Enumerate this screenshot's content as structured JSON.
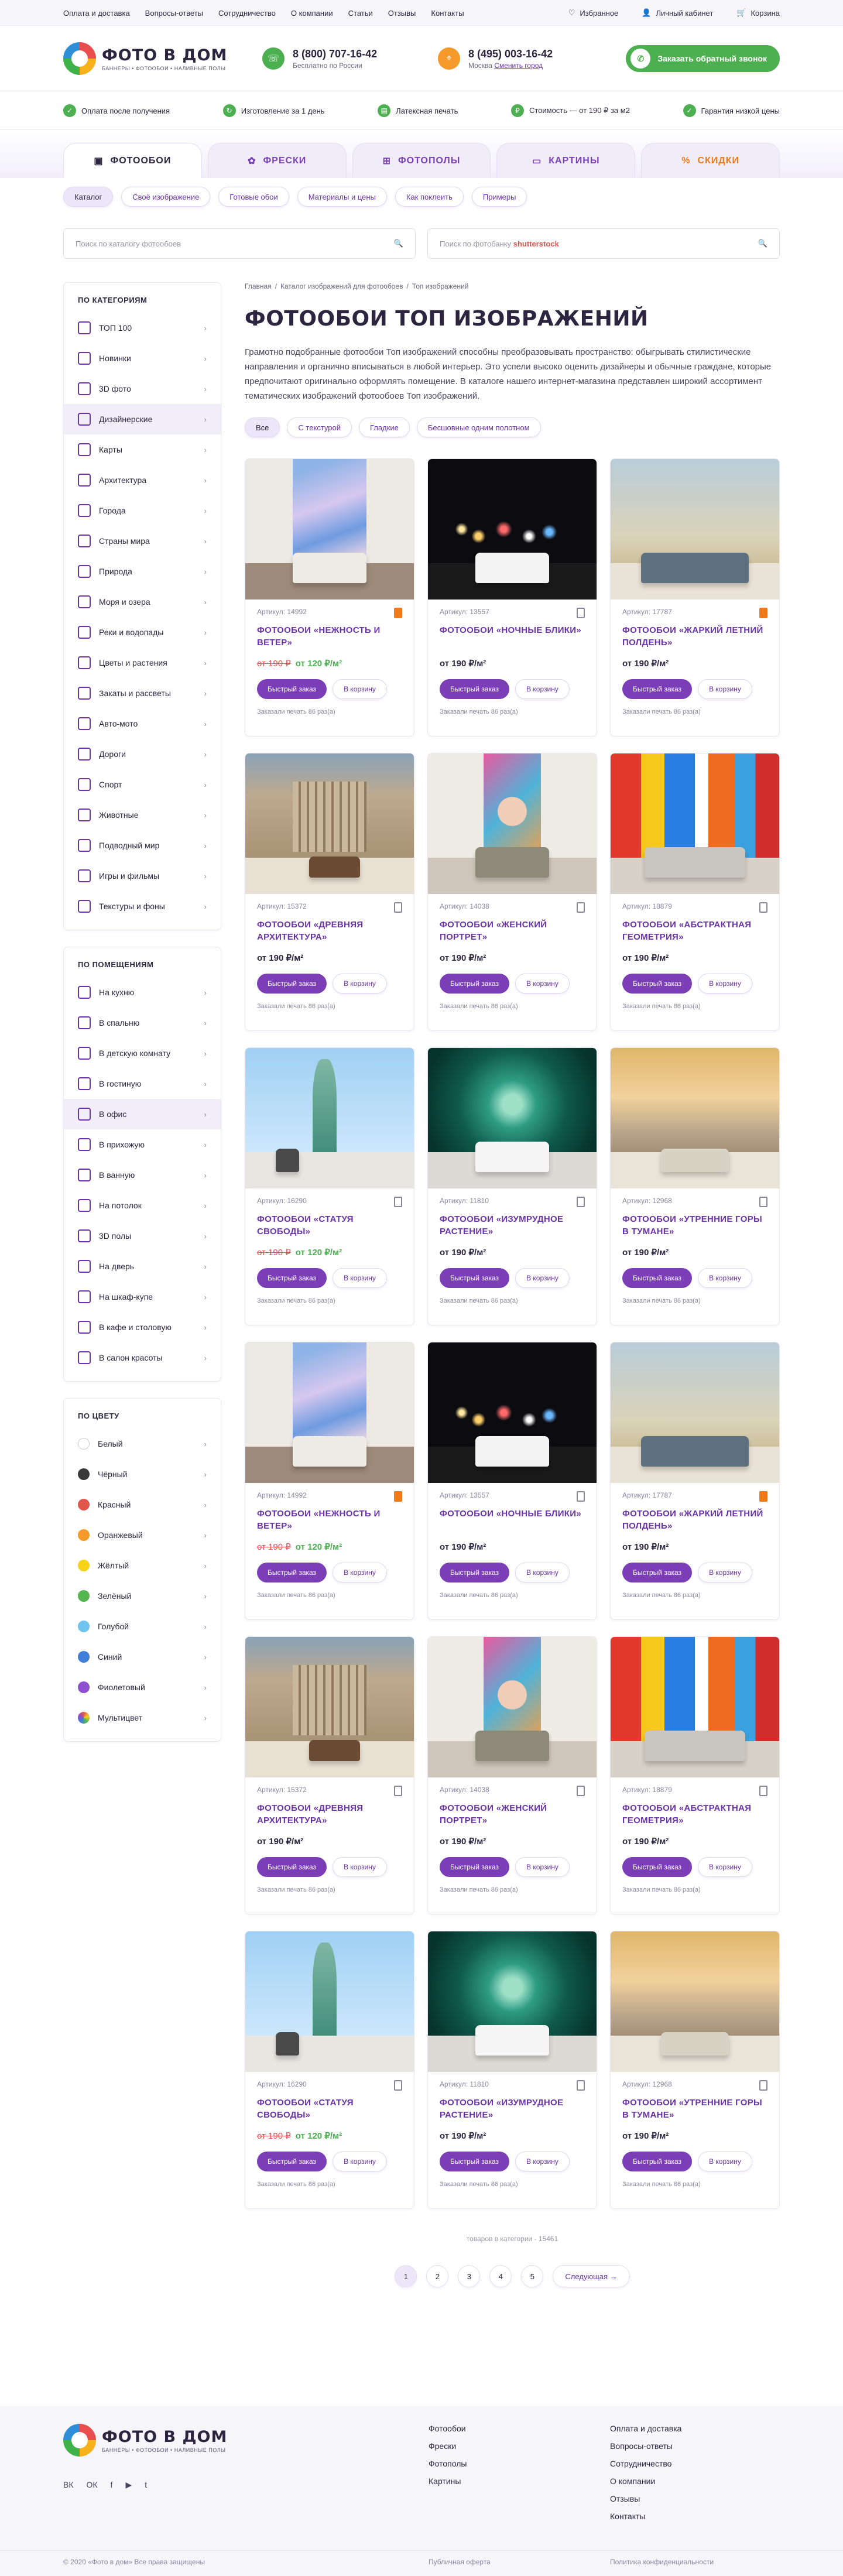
{
  "topbar": {
    "links": [
      "Оплата и доставка",
      "Вопросы-ответы",
      "Сотрудничество",
      "О компании",
      "Статьи",
      "Отзывы",
      "Контакты"
    ],
    "favorites": "Избранное",
    "cabinet": "Личный кабинет",
    "cart": "Корзина"
  },
  "header": {
    "logo_title": "ФОТО В ДОМ",
    "logo_sub": "БАННЕРЫ • ФОТООБОИ • НАЛИВНЫЕ ПОЛЫ",
    "phone1": "8 (800) 707-16-42",
    "phone1_note": "Бесплатно по России",
    "phone2": "8 (495) 003-16-42",
    "city": "Москва",
    "change_city": "Сменить город",
    "callback": "Заказать обратный звонок"
  },
  "benefits": [
    "Оплата после получения",
    "Изготовление за 1 день",
    "Латексная печать",
    "Стоимость — от 190 ₽ за м2",
    "Гарантия низкой цены"
  ],
  "tabs": [
    "ФОТООБОИ",
    "ФРЕСКИ",
    "ФОТОПОЛЫ",
    "КАРТИНЫ",
    "СКИДКИ"
  ],
  "subnav": [
    "Каталог",
    "Своё изображение",
    "Готовые обои",
    "Материалы и цены",
    "Как поклеить",
    "Примеры"
  ],
  "search": {
    "catalog_placeholder": "Поиск по каталогу фотообоев",
    "shutter_placeholder": "Поиск по фотобанку",
    "shutter_brand": "shutterstock"
  },
  "sidebar": {
    "categories_title": "ПО КАТЕГОРИЯМ",
    "categories": [
      "ТОП 100",
      "Новинки",
      "3D фото",
      "Дизайнерские",
      "Карты",
      "Архитектура",
      "Города",
      "Страны мира",
      "Природа",
      "Моря и озера",
      "Реки и водопады",
      "Цветы и растения",
      "Закаты и рассветы",
      "Авто-мото",
      "Дороги",
      "Спорт",
      "Животные",
      "Подводный мир",
      "Игры и фильмы",
      "Текстуры и фоны"
    ],
    "rooms_title": "ПО ПОМЕЩЕНИЯМ",
    "rooms": [
      "На кухню",
      "В спальню",
      "В детскую комнату",
      "В гостиную",
      "В офис",
      "В прихожую",
      "В ванную",
      "На потолок",
      "3D полы",
      "На дверь",
      "На шкаф-купе",
      "В кафе и столовую",
      "В салон красоты"
    ],
    "colors_title": "ПО ЦВЕТУ",
    "colors": [
      {
        "name": "Белый",
        "hex": "#ffffff"
      },
      {
        "name": "Чёрный",
        "hex": "#3a3a3a"
      },
      {
        "name": "Красный",
        "hex": "#e2574c"
      },
      {
        "name": "Оранжевый",
        "hex": "#f59a2a"
      },
      {
        "name": "Жёлтый",
        "hex": "#f6d21a"
      },
      {
        "name": "Зелёный",
        "hex": "#53b64f"
      },
      {
        "name": "Голубой",
        "hex": "#6ec4ef"
      },
      {
        "name": "Синий",
        "hex": "#3f7fd9"
      },
      {
        "name": "Фиолетовый",
        "hex": "#8f4fd1"
      },
      {
        "name": "Мультицвет",
        "hex": "multi"
      }
    ]
  },
  "breadcrumbs": [
    "Главная",
    "/",
    "Каталог изображений для фотообоев",
    "/",
    "Топ изображений"
  ],
  "page_title": "ФОТООБОИ ТОП ИЗОБРАЖЕНИЙ",
  "description": "Грамотно подобранные фотообои Топ изображений способны преобразовывать пространство: обыгрывать стилистические направления и органично вписываться в любой интерьер. Это успели высоко оценить дизайнеры и обычные граждане, которые предпочитают оригинально оформлять помещение. В каталоге нашего интернет-магазина представлен широкий ассортимент тематических изображений фотообоев Топ изображений.",
  "filters": [
    "Все",
    "С текстурой",
    "Гладкие",
    "Бесшовные одним полотном"
  ],
  "labels": {
    "article": "Артикул:",
    "quick_order": "Быстрый заказ",
    "to_cart": "В корзину",
    "ordered": "Заказали печать 86 раз(а)"
  },
  "products": [
    {
      "article": "14992",
      "title": "ФОТООБОИ «НЕЖНОСТЬ И ВЕТЕР»",
      "old_price": "от 190 ₽",
      "price": "от 120 ₽/м²",
      "sale": true,
      "fav": true,
      "scene": "pastel"
    },
    {
      "article": "13557",
      "title": "ФОТООБОИ «НОЧНЫЕ БЛИКИ»",
      "old_price": "",
      "price": "от 190 ₽/м²",
      "sale": false,
      "fav": false,
      "scene": "night"
    },
    {
      "article": "17787",
      "title": "ФОТООБОИ «ЖАРКИЙ ЛЕТНИЙ ПОЛДЕНЬ»",
      "old_price": "",
      "price": "от 190 ₽/м²",
      "sale": false,
      "fav": true,
      "scene": "savanna"
    },
    {
      "article": "15372",
      "title": "ФОТООБОИ «ДРЕВНЯЯ АРХИТЕКТУРА»",
      "old_price": "",
      "price": "от 190 ₽/м²",
      "sale": false,
      "fav": false,
      "scene": "rome"
    },
    {
      "article": "14038",
      "title": "ФОТООБОИ «ЖЕНСКИЙ ПОРТРЕТ»",
      "old_price": "",
      "price": "от 190 ₽/м²",
      "sale": false,
      "fav": false,
      "scene": "portrait"
    },
    {
      "article": "18879",
      "title": "ФОТООБОИ «АБСТРАКТНАЯ ГЕОМЕТРИЯ»",
      "old_price": "",
      "price": "от 190 ₽/м²",
      "sale": false,
      "fav": false,
      "scene": "abstract"
    },
    {
      "article": "16290",
      "title": "ФОТООБОИ «СТАТУЯ СВОБОДЫ»",
      "old_price": "от 190 ₽",
      "price": "от 120 ₽/м²",
      "sale": true,
      "fav": false,
      "scene": "liberty"
    },
    {
      "article": "11810",
      "title": "ФОТООБОИ «ИЗУМРУДНОЕ РАСТЕНИЕ»",
      "old_price": "",
      "price": "от 190 ₽/м²",
      "sale": false,
      "fav": false,
      "scene": "succulent"
    },
    {
      "article": "12968",
      "title": "ФОТООБОИ «УТРЕННИЕ ГОРЫ В ТУМАНЕ»",
      "old_price": "",
      "price": "от 190 ₽/м²",
      "sale": false,
      "fav": false,
      "scene": "fog"
    },
    {
      "article": "14992",
      "title": "ФОТООБОИ «НЕЖНОСТЬ И ВЕТЕР»",
      "old_price": "от 190 ₽",
      "price": "от 120 ₽/м²",
      "sale": true,
      "fav": true,
      "scene": "pastel"
    },
    {
      "article": "13557",
      "title": "ФОТООБОИ «НОЧНЫЕ БЛИКИ»",
      "old_price": "",
      "price": "от 190 ₽/м²",
      "sale": false,
      "fav": false,
      "scene": "night"
    },
    {
      "article": "17787",
      "title": "ФОТООБОИ «ЖАРКИЙ ЛЕТНИЙ ПОЛДЕНЬ»",
      "old_price": "",
      "price": "от 190 ₽/м²",
      "sale": false,
      "fav": true,
      "scene": "savanna"
    },
    {
      "article": "15372",
      "title": "ФОТООБОИ «ДРЕВНЯЯ АРХИТЕКТУРА»",
      "old_price": "",
      "price": "от 190 ₽/м²",
      "sale": false,
      "fav": false,
      "scene": "rome"
    },
    {
      "article": "14038",
      "title": "ФОТООБОИ «ЖЕНСКИЙ ПОРТРЕТ»",
      "old_price": "",
      "price": "от 190 ₽/м²",
      "sale": false,
      "fav": false,
      "scene": "portrait"
    },
    {
      "article": "18879",
      "title": "ФОТООБОИ «АБСТРАКТНАЯ ГЕОМЕТРИЯ»",
      "old_price": "",
      "price": "от 190 ₽/м²",
      "sale": false,
      "fav": false,
      "scene": "abstract"
    },
    {
      "article": "16290",
      "title": "ФОТООБОИ «СТАТУЯ СВОБОДЫ»",
      "old_price": "от 190 ₽",
      "price": "от 120 ₽/м²",
      "sale": true,
      "fav": false,
      "scene": "liberty"
    },
    {
      "article": "11810",
      "title": "ФОТООБОИ «ИЗУМРУДНОЕ РАСТЕНИЕ»",
      "old_price": "",
      "price": "от 190 ₽/м²",
      "sale": false,
      "fav": false,
      "scene": "succulent"
    },
    {
      "article": "12968",
      "title": "ФОТООБОИ «УТРЕННИЕ ГОРЫ В ТУМАНЕ»",
      "old_price": "",
      "price": "от 190 ₽/м²",
      "sale": false,
      "fav": false,
      "scene": "fog"
    }
  ],
  "count_text": "товаров в категории - 15461",
  "pagination": {
    "pages": [
      "1",
      "2",
      "3",
      "4",
      "5"
    ],
    "current": "1",
    "next": "Следующая →"
  },
  "footer": {
    "col1": [
      "Фотообои",
      "Фрески",
      "Фотополы",
      "Картины"
    ],
    "col2": [
      "Оплата и доставка",
      "Вопросы-ответы",
      "Сотрудничество",
      "О компании",
      "Отзывы",
      "Контакты"
    ],
    "social": [
      "ВК",
      "ОК",
      "f",
      "▶",
      "t"
    ],
    "copyright": "© 2020 «Фото в дом» Все права защищены",
    "offer": "Публичная оферта",
    "privacy": "Политика конфиденциальности"
  },
  "colors": {
    "accent": "#6b33a8",
    "green": "#4caf50",
    "orange": "#f07a1a",
    "sale": "#e24b4b"
  }
}
